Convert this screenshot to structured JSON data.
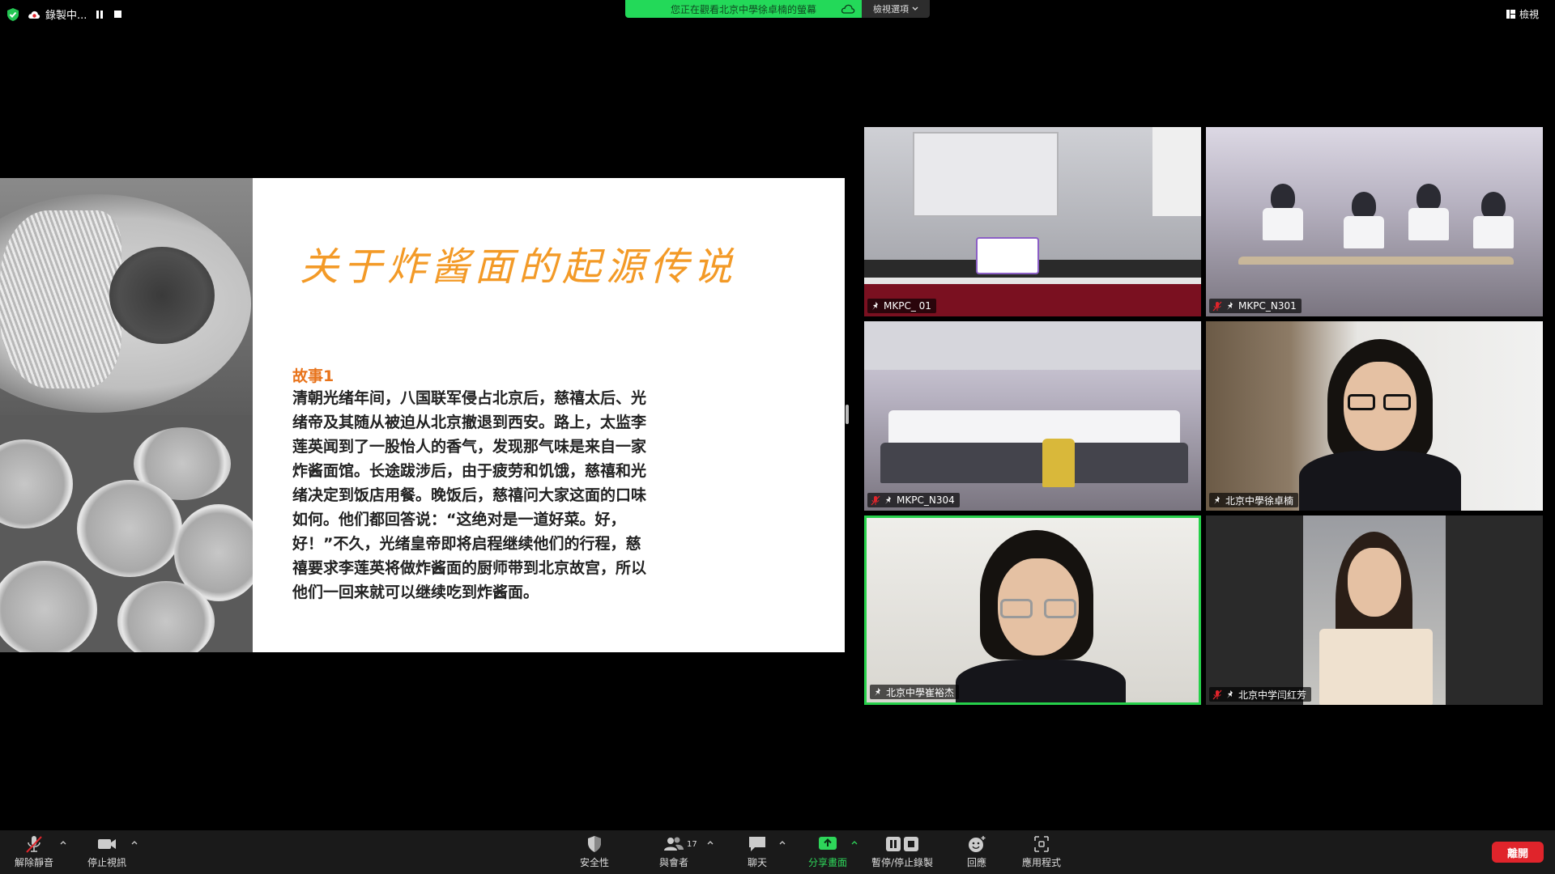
{
  "topbar": {
    "recording_label": "錄製中...",
    "viewing_banner": "您正在觀看北京中學徐卓楠的螢幕",
    "view_options": "檢視選項",
    "view_label": "檢視"
  },
  "slide": {
    "title": "关于炸酱面的起源传说",
    "story_label": "故事1",
    "story_lines": [
      "清朝光绪年间，八国联军侵占北京后，慈禧太后、光",
      "绪帝及其随从被迫从北京撤退到西安。路上，太监李",
      "莲英闻到了一股怡人的香气，发现那气味是来自一家",
      "炸酱面馆。长途跋涉后，由于疲劳和饥饿，慈禧和光",
      "绪决定到饭店用餐。晚饭后，慈禧问大家这面的口味",
      "如何。他们都回答说：“这绝对是一道好菜。好，",
      "好！”不久，光绪皇帝即将启程继续他们的行程，慈",
      "禧要求李莲英将做炸酱面的厨师带到北京故宫，所以",
      "他们一回来就可以继续吃到炸酱面。"
    ]
  },
  "participants": [
    {
      "name": "MKPC_ 01",
      "muted": false
    },
    {
      "name": "MKPC_N301",
      "muted": true
    },
    {
      "name": "MKPC_N304",
      "muted": true
    },
    {
      "name": "北京中學徐卓楠",
      "muted": false
    },
    {
      "name": "北京中學崔裕杰",
      "muted": false,
      "active": true
    },
    {
      "name": "北京中学闫红芳",
      "muted": true
    }
  ],
  "toolbar": {
    "unmute": "解除靜音",
    "stop_video": "停止視訊",
    "security": "安全性",
    "participants": "與會者",
    "participant_count": "17",
    "chat": "聊天",
    "share_screen": "分享畫面",
    "pause_stop_recording": "暫停/停止錄製",
    "reactions": "回應",
    "apps": "應用程式",
    "leave": "離開"
  },
  "colors": {
    "banner_green": "#23d959",
    "active_speaker": "#26d04a",
    "leave_red": "#e0242b",
    "slide_title": "#f39a27"
  }
}
